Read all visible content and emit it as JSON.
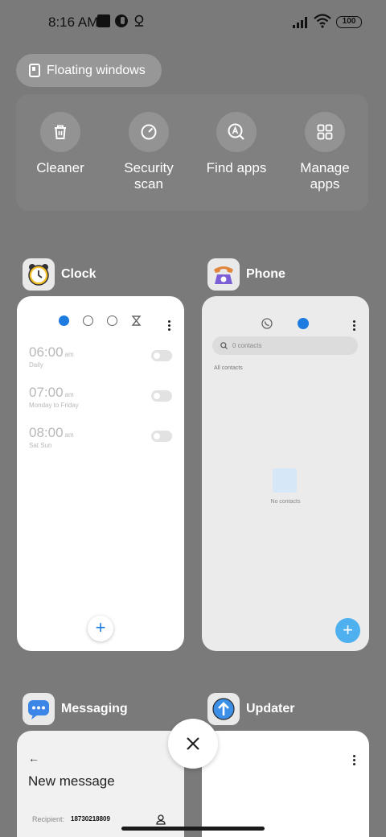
{
  "status_bar": {
    "time": "8:16 AM",
    "battery": "100"
  },
  "floating_windows": {
    "label": "Floating windows"
  },
  "quick_actions": [
    {
      "label": "Cleaner",
      "icon": "trash-icon"
    },
    {
      "label": "Security scan",
      "icon": "speedometer-icon"
    },
    {
      "label": "Find apps",
      "icon": "search-app-icon"
    },
    {
      "label": "Manage apps",
      "icon": "grid-icon"
    }
  ],
  "apps": {
    "clock": {
      "name": "Clock",
      "alarms": [
        {
          "time": "06:00",
          "ampm": "am",
          "repeat": "Daily"
        },
        {
          "time": "07:00",
          "ampm": "am",
          "repeat": "Monday to Friday"
        },
        {
          "time": "08:00",
          "ampm": "am",
          "repeat": "Sat Sun"
        }
      ],
      "fab": "+"
    },
    "phone": {
      "name": "Phone",
      "search_placeholder": "0 contacts",
      "filter": "All contacts",
      "empty_text": "No contacts",
      "fab": "+"
    },
    "messaging": {
      "name": "Messaging",
      "back": "←",
      "title": "New message",
      "recipient_label": "Recipient:",
      "recipient_value": "18730218809"
    },
    "updater": {
      "name": "Updater"
    }
  },
  "colors": {
    "accent_blue": "#1e7be0",
    "phone_fab": "#4fb0f0",
    "background": "#7a7a7a"
  }
}
